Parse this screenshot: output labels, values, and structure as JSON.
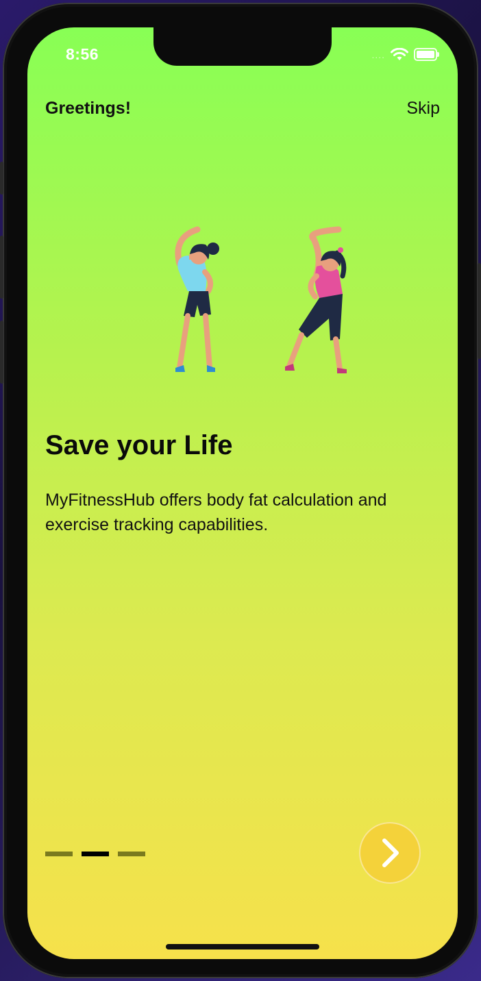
{
  "status_bar": {
    "time": "8:56",
    "signal_dots": "....",
    "icons": [
      "wifi-icon",
      "battery-icon"
    ]
  },
  "header": {
    "greeting": "Greetings!",
    "skip_label": "Skip"
  },
  "illustration": {
    "icon": "women-stretching-illustration"
  },
  "content": {
    "title": "Save your Life",
    "description": "MyFitnessHub offers body fat calculation and exercise tracking capabilities."
  },
  "pager": {
    "page_count": 3,
    "current_page": 2
  },
  "next_button": {
    "icon": "chevron-right-icon"
  },
  "colors": {
    "gradient_top": "#88ff55",
    "gradient_bottom": "#f6e14b",
    "button": "#f4d23a",
    "pager_inactive": "#7a7a1e",
    "pager_active": "#000000"
  }
}
